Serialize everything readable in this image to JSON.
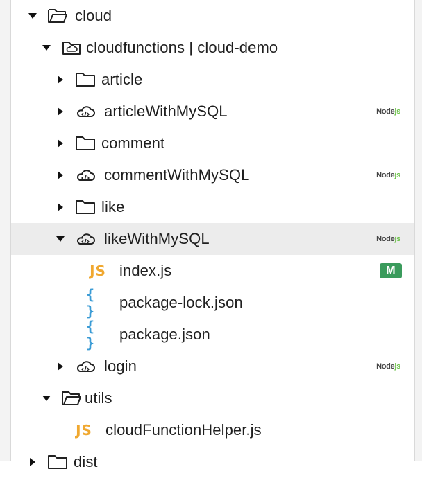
{
  "tree": {
    "cloud": {
      "label": "cloud"
    },
    "cloudfunctions": {
      "label": "cloudfunctions | cloud-demo"
    },
    "article": {
      "label": "article"
    },
    "articleWithMySQL": {
      "label": "articleWithMySQL",
      "badge_a": "Node",
      "badge_b": "js"
    },
    "comment": {
      "label": "comment"
    },
    "commentWithMySQL": {
      "label": "commentWithMySQL",
      "badge_a": "Node",
      "badge_b": "js"
    },
    "like": {
      "label": "like"
    },
    "likeWithMySQL": {
      "label": "likeWithMySQL",
      "badge_a": "Node",
      "badge_b": "js"
    },
    "index_js": {
      "label": "index.js",
      "icon_text": "JS",
      "status": "M"
    },
    "package_lock": {
      "label": "package-lock.json",
      "icon_text": "{ }"
    },
    "package_json": {
      "label": "package.json",
      "icon_text": "{ }"
    },
    "login": {
      "label": "login",
      "badge_a": "Node",
      "badge_b": "js"
    },
    "utils": {
      "label": "utils"
    },
    "helper": {
      "label": "cloudFunctionHelper.js",
      "icon_text": "JS"
    },
    "dist": {
      "label": "dist"
    }
  },
  "icons": {
    "folder": "folder-icon",
    "folder_open": "folder-open-icon",
    "cloud_folder": "cloud-folder-icon",
    "cloud_function": "cloud-function-icon",
    "js_file": "js-file-icon",
    "json_file": "json-file-icon"
  },
  "colors": {
    "selected_row": "#ececec",
    "js": "#f0a830",
    "json": "#3a9bd5",
    "modified_badge": "#3a9b5c",
    "node_js": "#6cc24a"
  }
}
